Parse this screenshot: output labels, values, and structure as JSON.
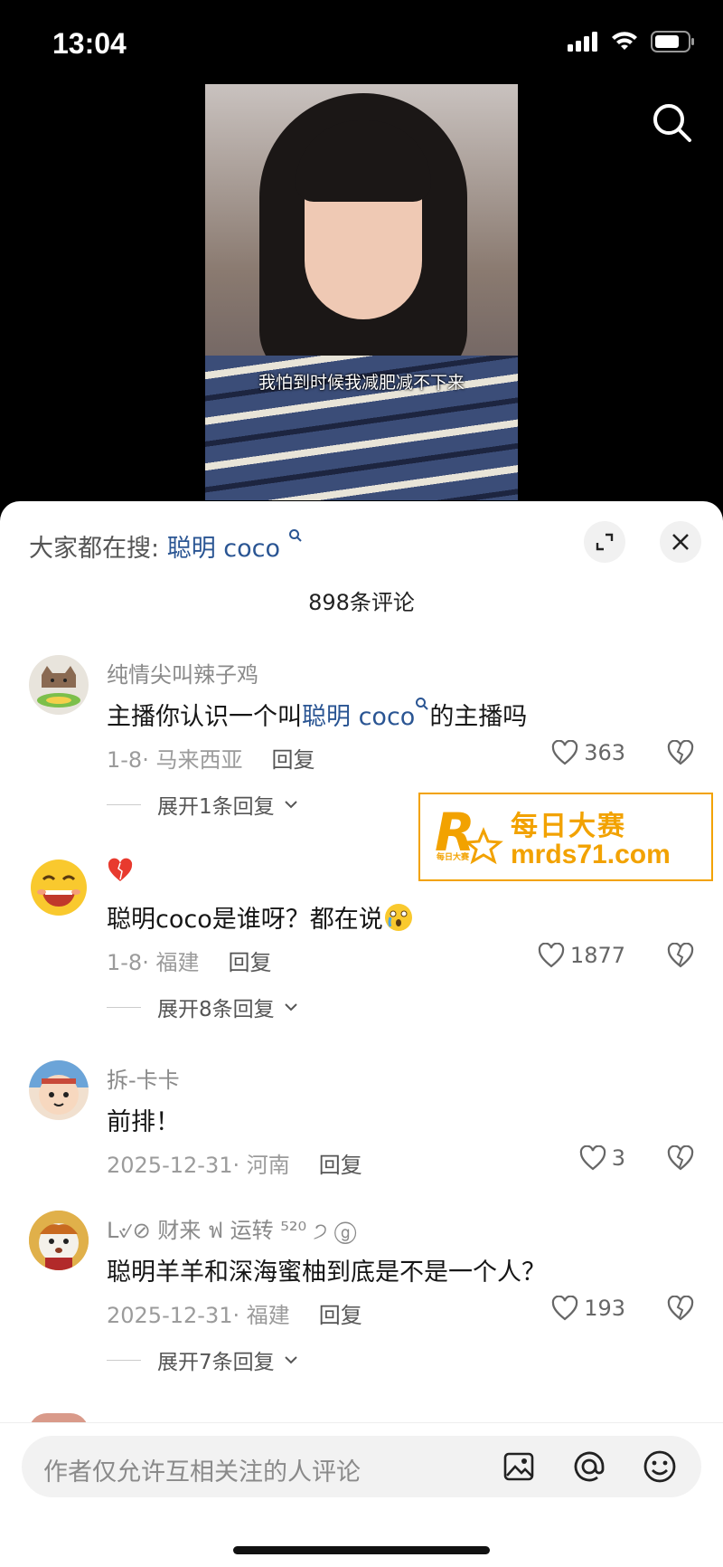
{
  "status_bar": {
    "time": "13:04"
  },
  "video": {
    "subtitle": "我怕到时候我减肥减不下来"
  },
  "sheet": {
    "hot_search_prefix": "大家都在搜:",
    "hot_search_keyword": "聪明 coco",
    "comment_count": "898条评论"
  },
  "comments": [
    {
      "name": "纯情尖叫辣子鸡",
      "text_before": "主播你认识一个叫",
      "text_kw": "聪明 coco",
      "text_after": "的主播吗",
      "date_loc": "1-8· 马来西亚",
      "reply": "回复",
      "likes": "363",
      "expand": "展开1条回复"
    },
    {
      "name": "",
      "text_before": "聪明coco是谁呀？都在说",
      "text_kw": "",
      "text_after": "",
      "date_loc": "1-8· 福建",
      "reply": "回复",
      "likes": "1877",
      "expand": "展开8条回复"
    },
    {
      "name": "拆-卡卡",
      "text_before": "前排！",
      "text_kw": "",
      "text_after": "",
      "date_loc": "2025-12-31· 河南",
      "reply": "回复",
      "likes": "3",
      "expand": ""
    },
    {
      "name": "L୰⊘ 财来 ฟ 运转 ⁵²⁰ ੭ ⓖ",
      "text_before": "聪明羊羊和深海蜜柚到底是不是一个人？",
      "text_kw": "",
      "text_after": "",
      "date_loc": "2025-12-31· 福建",
      "reply": "回复",
      "likes": "193",
      "expand": "展开7条回复"
    }
  ],
  "watermark": {
    "title": "每日大赛",
    "url": "mrds71.com",
    "badge": "每日大赛"
  },
  "composer": {
    "placeholder": "作者仅允许互相关注的人评论"
  },
  "colors": {
    "link": "#2a5593",
    "watermark_orange": "#f2a200"
  }
}
